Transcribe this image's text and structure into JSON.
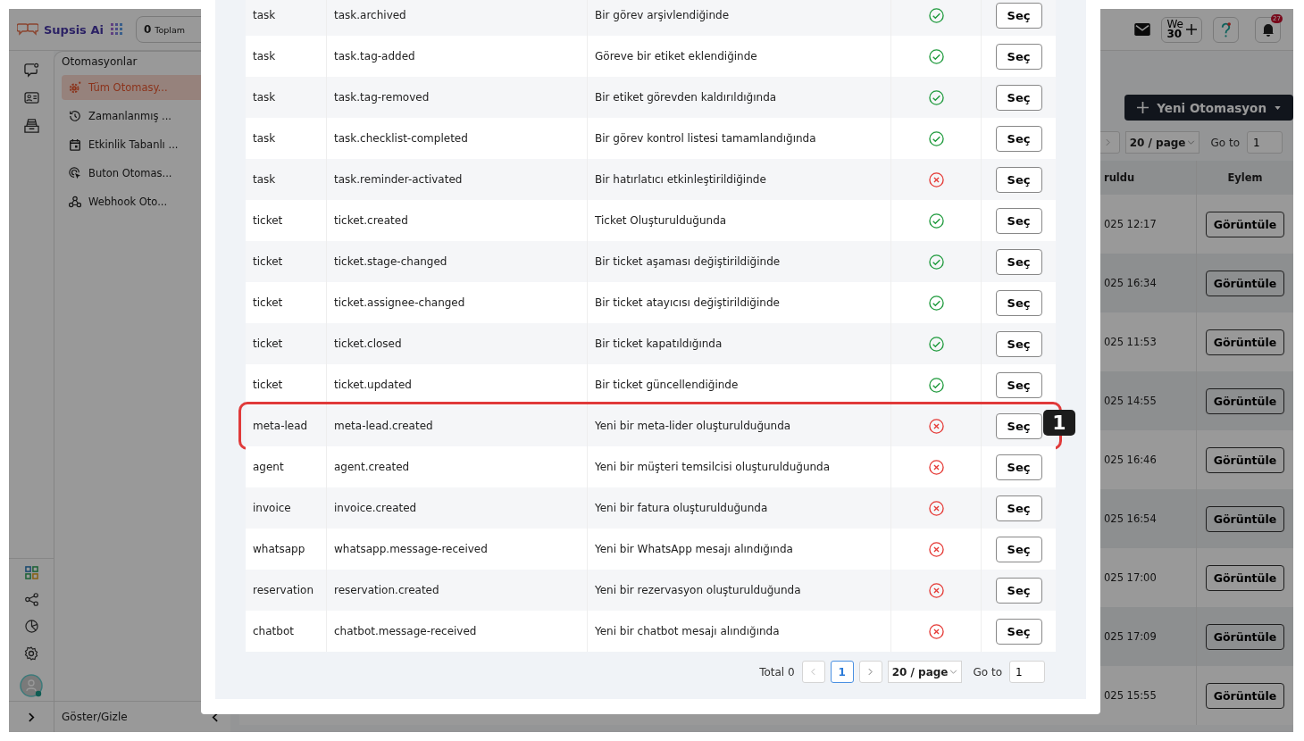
{
  "topbar": {
    "logo": "Supsis Ai",
    "stat_count": "0",
    "stat_label": "Toplam",
    "user_chip": {
      "line1": "We",
      "line2": "30"
    },
    "notification_count": "27"
  },
  "sidebar": {
    "title": "Otomasyonlar",
    "items": [
      {
        "label": "Tüm Otomasy...",
        "selected": true
      },
      {
        "label": "Zamanlanmış ...",
        "selected": false
      },
      {
        "label": "Etkinlik Tabanlı ...",
        "selected": false
      },
      {
        "label": "Buton Otomas...",
        "selected": false
      },
      {
        "label": "Webhook Oto...",
        "selected": false
      }
    ],
    "footer": "Göster/Gizle"
  },
  "main": {
    "new_button": "Yeni Otomasyon",
    "pagination": {
      "page_size": "20 / page",
      "goto_label": "Go to",
      "goto_value": "1"
    },
    "columns": [
      "ruldu",
      "Eylem"
    ],
    "rows": [
      {
        "date": "025 12:17",
        "action": "Görüntüle"
      },
      {
        "date": "025 16:34",
        "action": "Görüntüle"
      },
      {
        "date": "025 11:53",
        "action": "Görüntüle"
      },
      {
        "date": "025 14:55",
        "action": "Görüntüle"
      },
      {
        "date": "025 16:46",
        "action": "Görüntüle"
      },
      {
        "date": "025 16:54",
        "action": "Görüntüle"
      },
      {
        "date": "025 17:00",
        "action": "Görüntüle"
      },
      {
        "date": "025 17:09",
        "action": "Görüntüle"
      },
      {
        "date": "025 15:55",
        "action": "Görüntüle"
      }
    ]
  },
  "modal": {
    "rows": [
      {
        "type": "task",
        "event": "task.archived",
        "description": "Bir görev arşivlendiğinde",
        "enabled": true,
        "action": "Seç",
        "highlighted": false
      },
      {
        "type": "task",
        "event": "task.tag-added",
        "description": "Göreve bir etiket eklendiğinde",
        "enabled": true,
        "action": "Seç",
        "highlighted": false
      },
      {
        "type": "task",
        "event": "task.tag-removed",
        "description": "Bir etiket görevden kaldırıldığında",
        "enabled": true,
        "action": "Seç",
        "highlighted": false
      },
      {
        "type": "task",
        "event": "task.checklist-completed",
        "description": "Bir görev kontrol listesi tamamlandığında",
        "enabled": true,
        "action": "Seç",
        "highlighted": false
      },
      {
        "type": "task",
        "event": "task.reminder-activated",
        "description": "Bir hatırlatıcı etkinleştirildiğinde",
        "enabled": false,
        "action": "Seç",
        "highlighted": false
      },
      {
        "type": "ticket",
        "event": "ticket.created",
        "description": "Ticket Oluşturulduğunda",
        "enabled": true,
        "action": "Seç",
        "highlighted": false
      },
      {
        "type": "ticket",
        "event": "ticket.stage-changed",
        "description": "Bir ticket aşaması değiştirildiğinde",
        "enabled": true,
        "action": "Seç",
        "highlighted": false
      },
      {
        "type": "ticket",
        "event": "ticket.assignee-changed",
        "description": "Bir ticket atayıcısı değiştirildiğinde",
        "enabled": true,
        "action": "Seç",
        "highlighted": false
      },
      {
        "type": "ticket",
        "event": "ticket.closed",
        "description": "Bir ticket kapatıldığında",
        "enabled": true,
        "action": "Seç",
        "highlighted": false
      },
      {
        "type": "ticket",
        "event": "ticket.updated",
        "description": "Bir ticket güncellendiğinde",
        "enabled": true,
        "action": "Seç",
        "highlighted": false
      },
      {
        "type": "meta-lead",
        "event": "meta-lead.created",
        "description": "Yeni bir meta-lider oluşturulduğunda",
        "enabled": false,
        "action": "Seç",
        "highlighted": true,
        "annotation": "1"
      },
      {
        "type": "agent",
        "event": "agent.created",
        "description": "Yeni bir müşteri temsilcisi oluşturulduğunda",
        "enabled": false,
        "action": "Seç",
        "highlighted": false
      },
      {
        "type": "invoice",
        "event": "invoice.created",
        "description": "Yeni bir fatura oluşturulduğunda",
        "enabled": false,
        "action": "Seç",
        "highlighted": false
      },
      {
        "type": "whatsapp",
        "event": "whatsapp.message-received",
        "description": "Yeni bir WhatsApp mesajı alındığında",
        "enabled": false,
        "action": "Seç",
        "highlighted": false
      },
      {
        "type": "reservation",
        "event": "reservation.created",
        "description": "Yeni bir rezervasyon oluşturulduğunda",
        "enabled": false,
        "action": "Seç",
        "highlighted": false
      },
      {
        "type": "chatbot",
        "event": "chatbot.message-received",
        "description": "Yeni bir chatbot mesajı alındığında",
        "enabled": false,
        "action": "Seç",
        "highlighted": false
      }
    ],
    "pagination": {
      "total": "Total 0",
      "current": "1",
      "page_size": "20 / page",
      "goto_label": "Go to",
      "goto_value": "1"
    }
  }
}
